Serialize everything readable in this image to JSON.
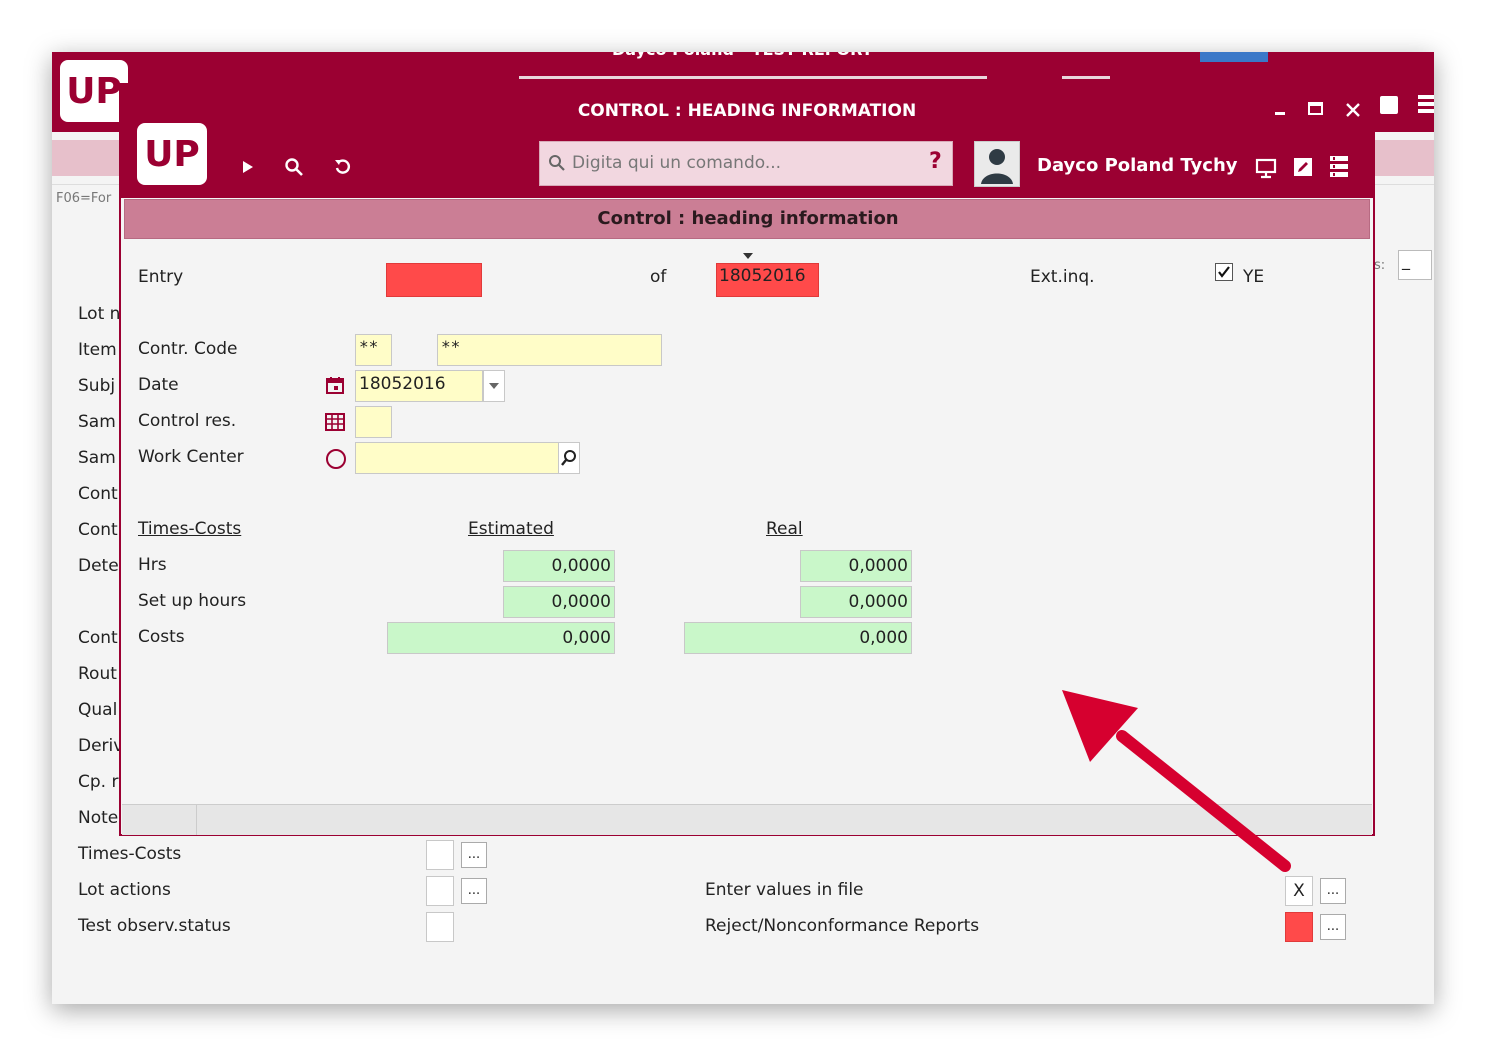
{
  "background_window": {
    "title": "Dayco Poland - TEST REPORT",
    "logo": "UP",
    "function_keys": "F06=For",
    "right_label": "s:",
    "right_field_value": "_",
    "side_labels": [
      "Lot n",
      "Item",
      "Subj",
      "Sam",
      "Sam",
      "Cont",
      "Cont",
      "Dete",
      "Cont",
      "Rout",
      "Qual",
      "Deriv",
      "Cp. r",
      "Note"
    ],
    "bottom_rows": [
      {
        "label": "Times-Costs",
        "dots": "..."
      },
      {
        "label": "Lot actions",
        "dots": "..."
      },
      {
        "label": "Test observ.status"
      }
    ],
    "right_rows": [
      {
        "label": "Enter values in file",
        "value": "X",
        "dots": "..."
      },
      {
        "label": "Reject/Nonconformance Reports",
        "dots": "...",
        "color": "#ff4a4a"
      }
    ]
  },
  "dialog": {
    "title": "CONTROL : HEADING INFORMATION",
    "logo": "UP",
    "window_controls": {
      "minimize": "‗",
      "maximize": "☐",
      "close": "✕"
    },
    "command_placeholder": "Digita qui un comando...",
    "help": "?",
    "company": "Dayco Poland Tychy",
    "section_title": "Control : heading information",
    "form": {
      "entry_label": "Entry",
      "of_label": "of",
      "of_value": "18052016",
      "extinq_label": "Ext.inq.",
      "extinq_value": "YE",
      "contr_code_label": "Contr. Code",
      "contr_code_1": "**",
      "contr_code_2": "**",
      "date_label": "Date",
      "date_value": "18052016",
      "control_res_label": "Control res.",
      "work_center_label": "Work Center"
    },
    "times_costs": {
      "header": "Times-Costs",
      "estimated_header": "Estimated",
      "real_header": "Real",
      "rows": [
        {
          "label": "Hrs",
          "estimated": "0,0000",
          "real": "0,0000"
        },
        {
          "label": "Set up hours",
          "estimated": "0,0000",
          "real": "0,0000"
        },
        {
          "label": "Costs",
          "estimated": "0,000",
          "real": "0,000"
        }
      ]
    }
  },
  "colors": {
    "brand": "#9b0032",
    "section_header": "#cb7e95",
    "required_field": "#ff4a4a",
    "input_yellow": "#fffdc8",
    "numeric_green": "#c9f7c9",
    "annotation_arrow": "#d6002f"
  }
}
